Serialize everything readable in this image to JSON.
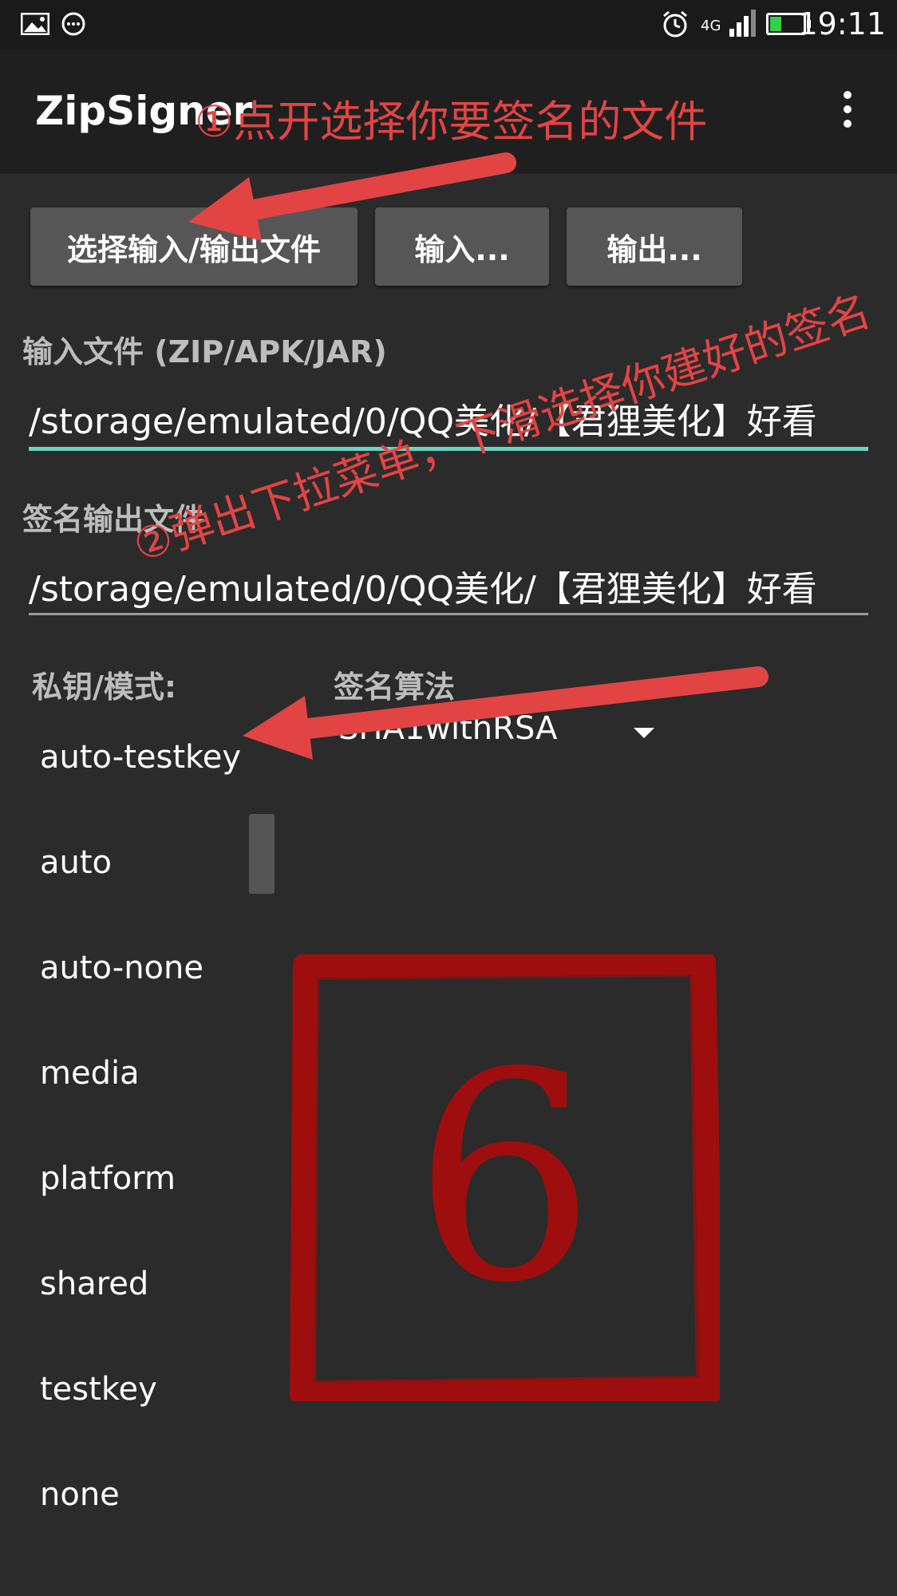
{
  "status_bar": {
    "time": "19:11",
    "network": "4G",
    "icons": [
      "image-icon",
      "chat-bubble-icon",
      "alarm-icon",
      "signal-icon",
      "battery-icon"
    ]
  },
  "app": {
    "title": "ZipSigner"
  },
  "buttons": {
    "select_io": "选择输入/输出文件",
    "input": "输入...",
    "output": "输出..."
  },
  "input_file": {
    "label": "输入文件 (ZIP/APK/JAR)",
    "value": "/storage/emulated/0/QQ美化/【君狸美化】好看"
  },
  "output_file": {
    "label": "签名输出文件",
    "value": "/storage/emulated/0/QQ美化/【君狸美化】好看"
  },
  "key_mode": {
    "label": "私钥/模式:",
    "options": [
      "auto-testkey",
      "auto",
      "auto-none",
      "media",
      "platform",
      "shared",
      "testkey",
      "none"
    ]
  },
  "signature_algorithm": {
    "label": "签名算法",
    "selected": "SHA1withRSA"
  },
  "annotations": {
    "step1": "①点开选择你要签名的文件",
    "step2": "②弹出下拉菜单，下滑选择你建好的签名"
  },
  "stamp": {
    "number": "6"
  },
  "colors": {
    "accent_underline": "#6ad3c2",
    "annotation_red": "#e24444",
    "stamp_red": "#9e0e0e"
  }
}
